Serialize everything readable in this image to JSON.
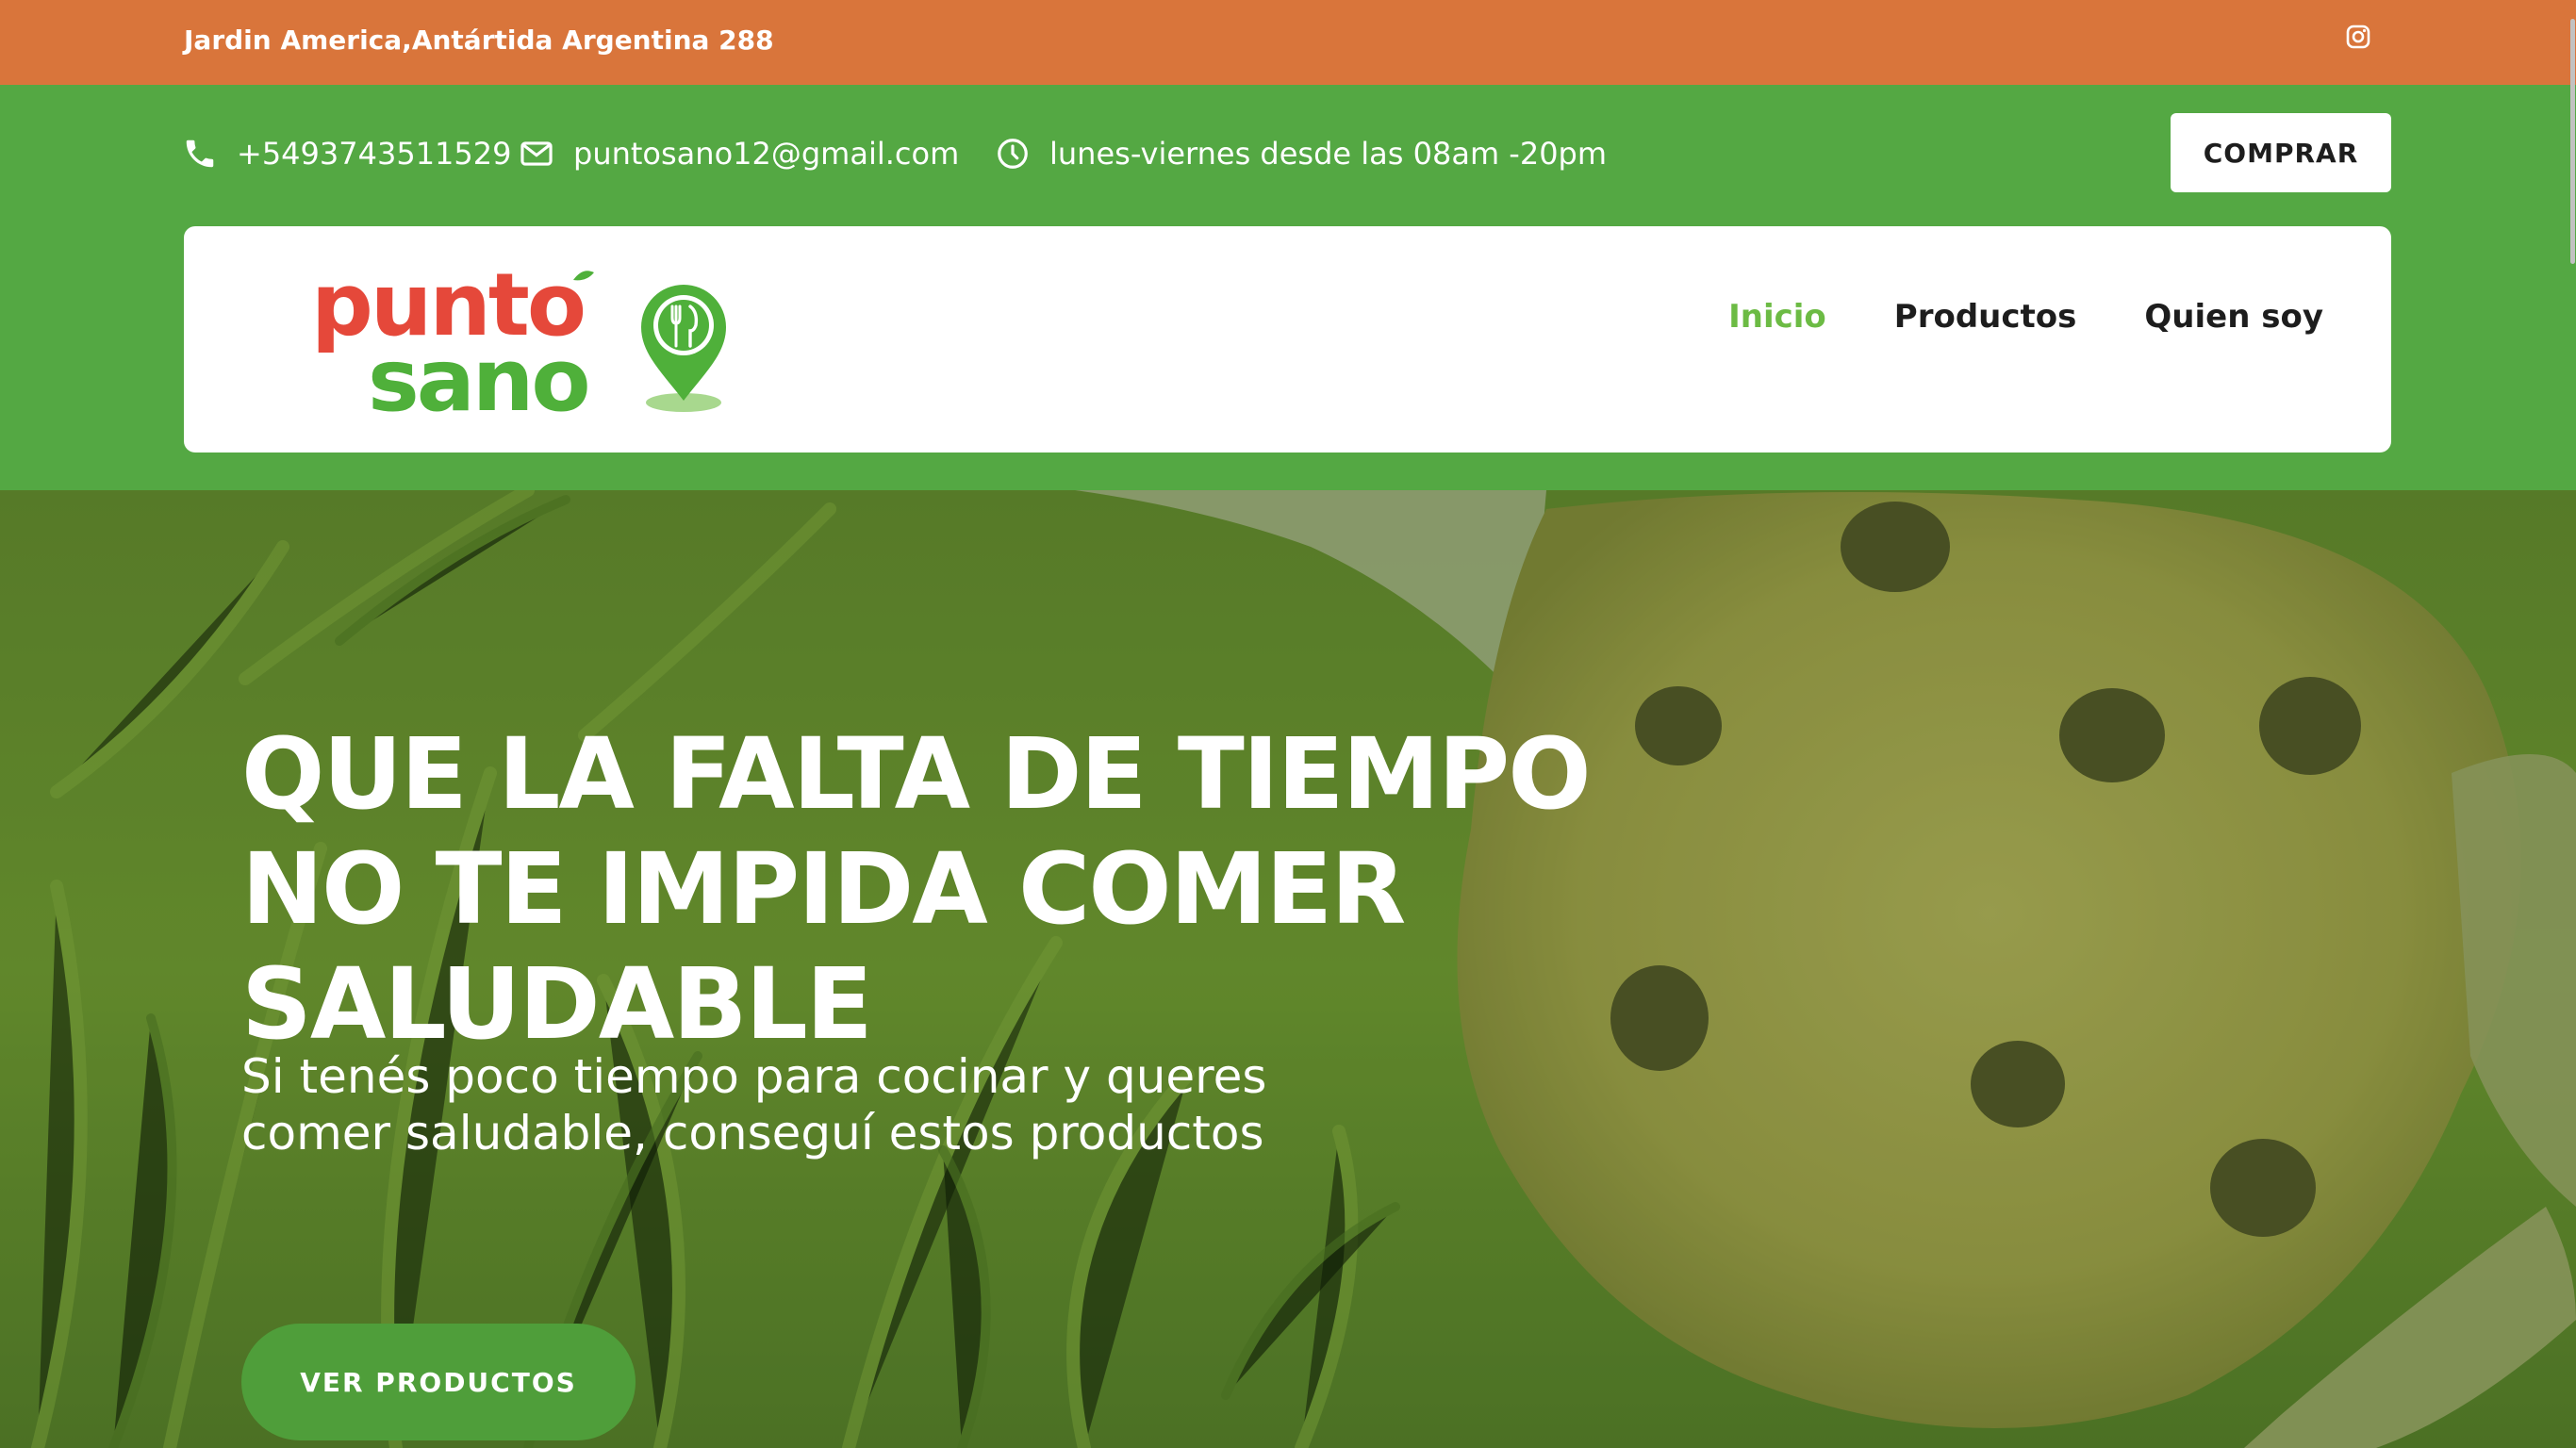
{
  "topbar": {
    "address": "Jardin America,Antártida Argentina 288",
    "social_icon": "instagram-icon"
  },
  "info": {
    "phone": "+5493743511529",
    "email": "puntosano12@gmail.com",
    "hours": "lunes-viernes desde las 08am -20pm",
    "buy_label": "COMPRAR"
  },
  "logo": {
    "line1": "punto",
    "line2": "sano"
  },
  "nav": {
    "items": [
      {
        "label": "Inicio",
        "active": true
      },
      {
        "label": "Productos",
        "active": false
      },
      {
        "label": "Quien soy",
        "active": false
      }
    ]
  },
  "hero": {
    "title": "QUE LA FALTA DE TIEMPO NO TE IMPIDA COMER SALUDABLE",
    "subtitle": "Si tenés poco tiempo para cocinar y queres comer saludable, conseguí estos productos",
    "cta_label": "VER PRODUCTOS"
  },
  "colors": {
    "topbar": "#d9753b",
    "green": "#54a843",
    "accent": "#6cbb44",
    "logo_red": "#e5483a",
    "logo_green": "#4fb03a"
  }
}
